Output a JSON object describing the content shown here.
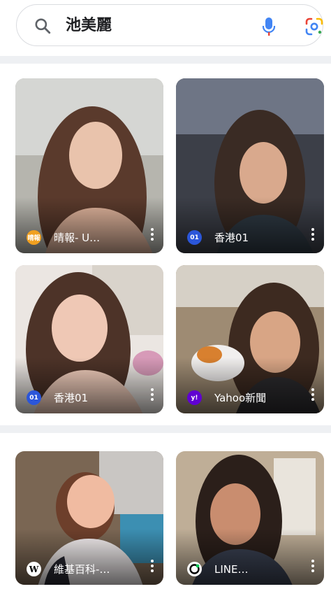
{
  "search": {
    "query": "池美麗"
  },
  "results": [
    {
      "source": "晴報- U…",
      "favicon_text": "晴報",
      "favicon_color": "#f0a020"
    },
    {
      "source": "香港01",
      "favicon_text": "01",
      "favicon_color": "#2b56d9"
    },
    {
      "source": "香港01",
      "favicon_text": "01",
      "favicon_color": "#2b56d9"
    },
    {
      "source": "Yahoo新聞",
      "favicon_text": "y!",
      "favicon_color": "#6001d2"
    },
    {
      "source": "維基百科-…",
      "favicon_text": "W",
      "favicon_color": "#ffffff"
    },
    {
      "source": "LINE…",
      "favicon_text": "",
      "favicon_color": "#ffffff"
    }
  ],
  "colors": {
    "mic_blue": "#4285f4",
    "mic_red": "#ea4335",
    "lens_yellow": "#fbbc04",
    "lens_green": "#34a853",
    "divider": "#eef0f3"
  },
  "icons": [
    "search-icon",
    "microphone-icon",
    "google-lens-icon",
    "more-vert-icon"
  ]
}
